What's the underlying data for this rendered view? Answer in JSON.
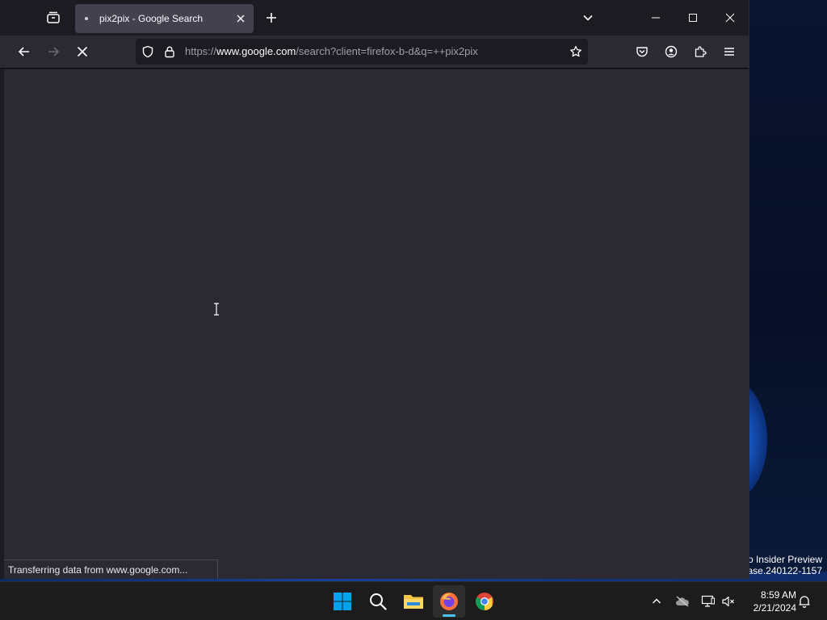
{
  "browser": {
    "tab": {
      "title": "pix2pix - Google Search"
    },
    "url": {
      "scheme": "https://",
      "host": "www.google.com",
      "path": "/search?client=firefox-b-d&q=++pix2pix"
    },
    "status": "Transferring data from www.google.com..."
  },
  "desktop": {
    "watermark_line1": "ro Insider Preview",
    "watermark_line2": "ease.240122-1157"
  },
  "taskbar": {
    "time": "8:59 AM",
    "date": "2/21/2024"
  },
  "icons": {
    "tab_overview": "firefox-view-icon",
    "close": "close-icon",
    "new_tab": "plus-icon",
    "tab_list": "chevron-down-icon",
    "back": "back-arrow-icon",
    "forward": "forward-arrow-icon",
    "stop": "stop-loading-icon",
    "tracking": "shield-icon",
    "lock": "lock-icon",
    "bookmark": "star-icon",
    "pocket": "pocket-icon",
    "account": "account-icon",
    "extensions": "puzzle-icon",
    "menu": "hamburger-menu-icon"
  },
  "colors": {
    "accent": "#4cc2ff",
    "firefox_orange": "#ff7139",
    "windows_blue": "#00a2ed"
  }
}
